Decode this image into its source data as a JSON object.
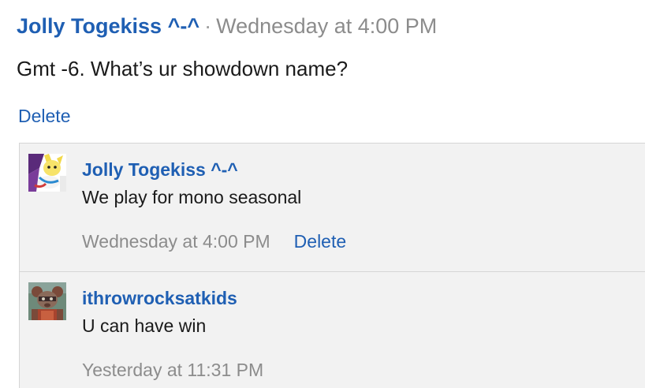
{
  "message": {
    "author": "Jolly Togekiss ^-^",
    "separator": "·",
    "timestamp": "Wednesday at 4:00 PM",
    "body": "Gmt -6. What’s ur showdown name?",
    "delete_label": "Delete"
  },
  "comments": [
    {
      "author": "Jolly Togekiss ^-^",
      "text": "We play for mono seasonal",
      "timestamp": "Wednesday at 4:00 PM",
      "delete_label": "Delete",
      "avatar_icon": "togekiss-avatar-icon"
    },
    {
      "author": "ithrowrocksatkids",
      "text": "U can have win",
      "timestamp": "Yesterday at 11:31 PM",
      "avatar_icon": "rat-character-avatar-icon"
    }
  ],
  "colors": {
    "link": "#1f5fb3",
    "muted": "#8c8c8c",
    "text": "#1a1a1a",
    "comment_bg": "#f2f2f2",
    "border": "#d6d6d6"
  }
}
